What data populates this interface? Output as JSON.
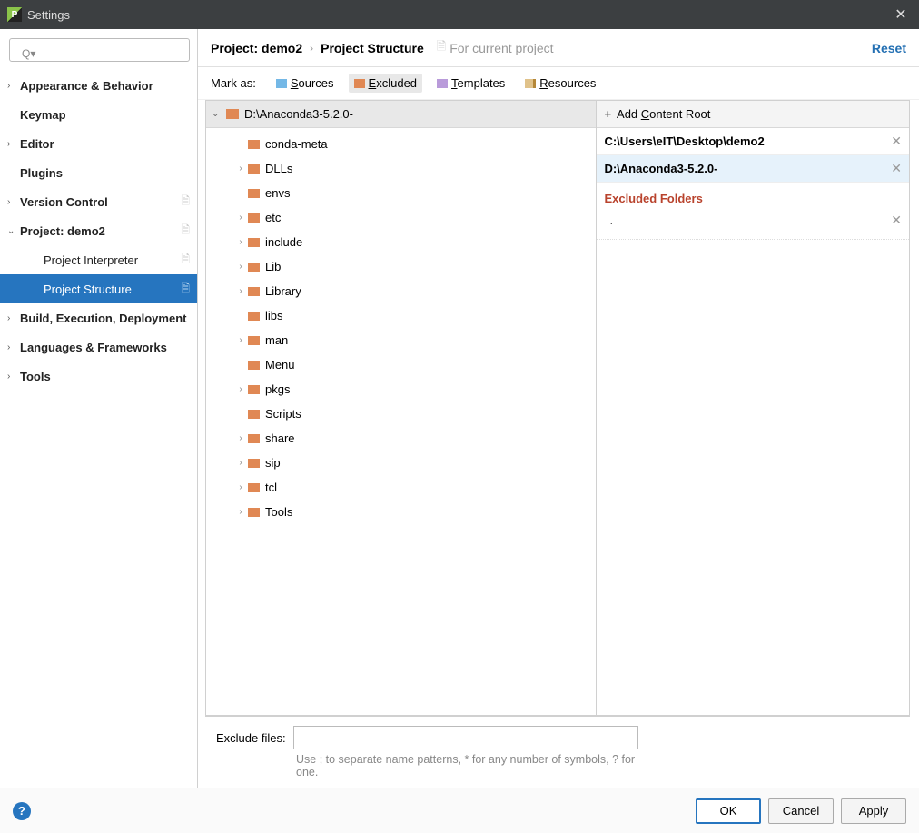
{
  "window": {
    "title": "Settings"
  },
  "breadcrumb": {
    "a": "Project: demo2",
    "b": "Project Structure",
    "hint": "For current project",
    "reset": "Reset"
  },
  "sidebar": {
    "items": [
      {
        "label": "Appearance & Behavior",
        "chev": "›",
        "bold": true
      },
      {
        "label": "Keymap",
        "chev": "",
        "bold": true
      },
      {
        "label": "Editor",
        "chev": "›",
        "bold": true
      },
      {
        "label": "Plugins",
        "chev": "",
        "bold": true
      },
      {
        "label": "Version Control",
        "chev": "›",
        "bold": true,
        "badge": true
      },
      {
        "label": "Project: demo2",
        "chev": "⌄",
        "bold": true,
        "badge": true
      },
      {
        "label": "Project Interpreter",
        "chev": "",
        "bold": false,
        "child": true,
        "badge": true
      },
      {
        "label": "Project Structure",
        "chev": "",
        "bold": false,
        "child": true,
        "badge": true,
        "selected": true
      },
      {
        "label": "Build, Execution, Deployment",
        "chev": "›",
        "bold": true
      },
      {
        "label": "Languages & Frameworks",
        "chev": "›",
        "bold": true
      },
      {
        "label": "Tools",
        "chev": "›",
        "bold": true
      }
    ]
  },
  "markbar": {
    "label": "Mark as:",
    "sources": "Sources",
    "excluded": "Excluded",
    "templates": "Templates",
    "resources": "Resources"
  },
  "tree": {
    "root": "D:\\Anaconda3-5.2.0-",
    "items": [
      {
        "name": "conda-meta",
        "exp": false
      },
      {
        "name": "DLLs",
        "exp": true
      },
      {
        "name": "envs",
        "exp": false
      },
      {
        "name": "etc",
        "exp": true
      },
      {
        "name": "include",
        "exp": true
      },
      {
        "name": "Lib",
        "exp": true
      },
      {
        "name": "Library",
        "exp": true
      },
      {
        "name": "libs",
        "exp": false
      },
      {
        "name": "man",
        "exp": true
      },
      {
        "name": "Menu",
        "exp": false
      },
      {
        "name": "pkgs",
        "exp": true
      },
      {
        "name": "Scripts",
        "exp": false
      },
      {
        "name": "share",
        "exp": true
      },
      {
        "name": "sip",
        "exp": true
      },
      {
        "name": "tcl",
        "exp": true
      },
      {
        "name": "Tools",
        "exp": true
      }
    ]
  },
  "right": {
    "add_root": "Add Content Root",
    "roots": [
      {
        "path": "C:\\Users\\eIT\\Desktop\\demo2",
        "sel": false
      },
      {
        "path": "D:\\Anaconda3-5.2.0-",
        "sel": true
      }
    ],
    "excluded_header": "Excluded Folders",
    "excluded_item": "."
  },
  "exclude": {
    "label": "Exclude files:",
    "hint": "Use ; to separate name patterns, * for any number of symbols, ? for one."
  },
  "footer": {
    "ok": "OK",
    "cancel": "Cancel",
    "apply": "Apply"
  }
}
